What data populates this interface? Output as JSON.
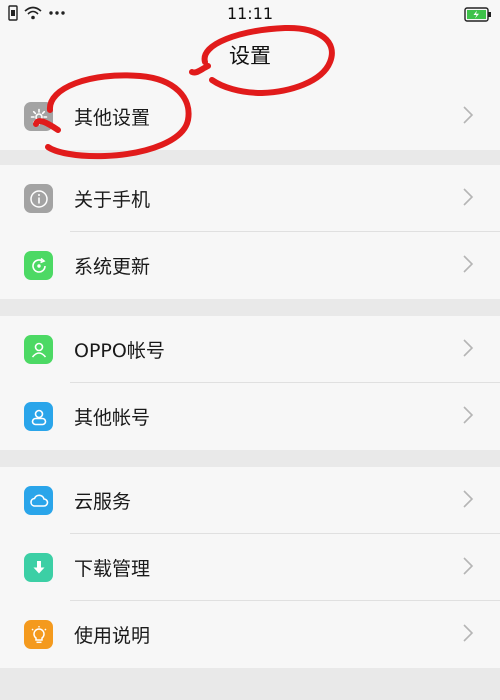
{
  "status": {
    "time": "11:11"
  },
  "header": {
    "title": "设置"
  },
  "colors": {
    "gray_icon": "#a3a3a3",
    "green_icon": "#4cd964",
    "blue_icon": "#2aa5ea",
    "teal_icon": "#3ccfa5",
    "orange_icon": "#f49a1e",
    "annotation": "#e11b1b"
  },
  "groups": [
    {
      "items": [
        {
          "label": "其他设置",
          "icon": "gear-icon"
        }
      ]
    },
    {
      "items": [
        {
          "label": "关于手机",
          "icon": "info-icon"
        },
        {
          "label": "系统更新",
          "icon": "update-icon"
        }
      ]
    },
    {
      "items": [
        {
          "label": "OPPO帐号",
          "icon": "person-icon"
        },
        {
          "label": "其他帐号",
          "icon": "person-outline-icon"
        }
      ]
    },
    {
      "items": [
        {
          "label": "云服务",
          "icon": "cloud-icon"
        },
        {
          "label": "下载管理",
          "icon": "download-icon"
        },
        {
          "label": "使用说明",
          "icon": "bulb-icon"
        }
      ]
    }
  ]
}
